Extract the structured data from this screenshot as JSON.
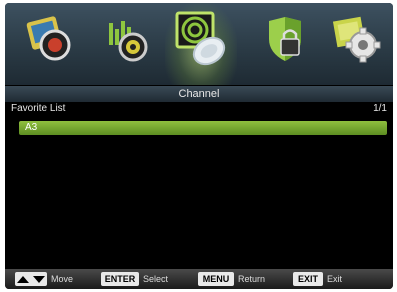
{
  "menu": {
    "title": "Channel",
    "tabs": [
      {
        "icon": "picture-icon",
        "selected": false
      },
      {
        "icon": "sound-icon",
        "selected": false
      },
      {
        "icon": "channel-icon",
        "selected": true
      },
      {
        "icon": "lock-icon",
        "selected": false
      },
      {
        "icon": "settings-icon",
        "selected": false
      }
    ]
  },
  "list": {
    "header_label": "Favorite List",
    "page_indicator": "1/1",
    "items": [
      "A3"
    ]
  },
  "footer": {
    "move_label": "Move",
    "enter_key": "ENTER",
    "enter_label": "Select",
    "menu_key": "MENU",
    "menu_label": "Return",
    "exit_key": "EXIT",
    "exit_label": "Exit"
  },
  "colors": {
    "highlight": "#7aa831",
    "background": "#000000"
  }
}
